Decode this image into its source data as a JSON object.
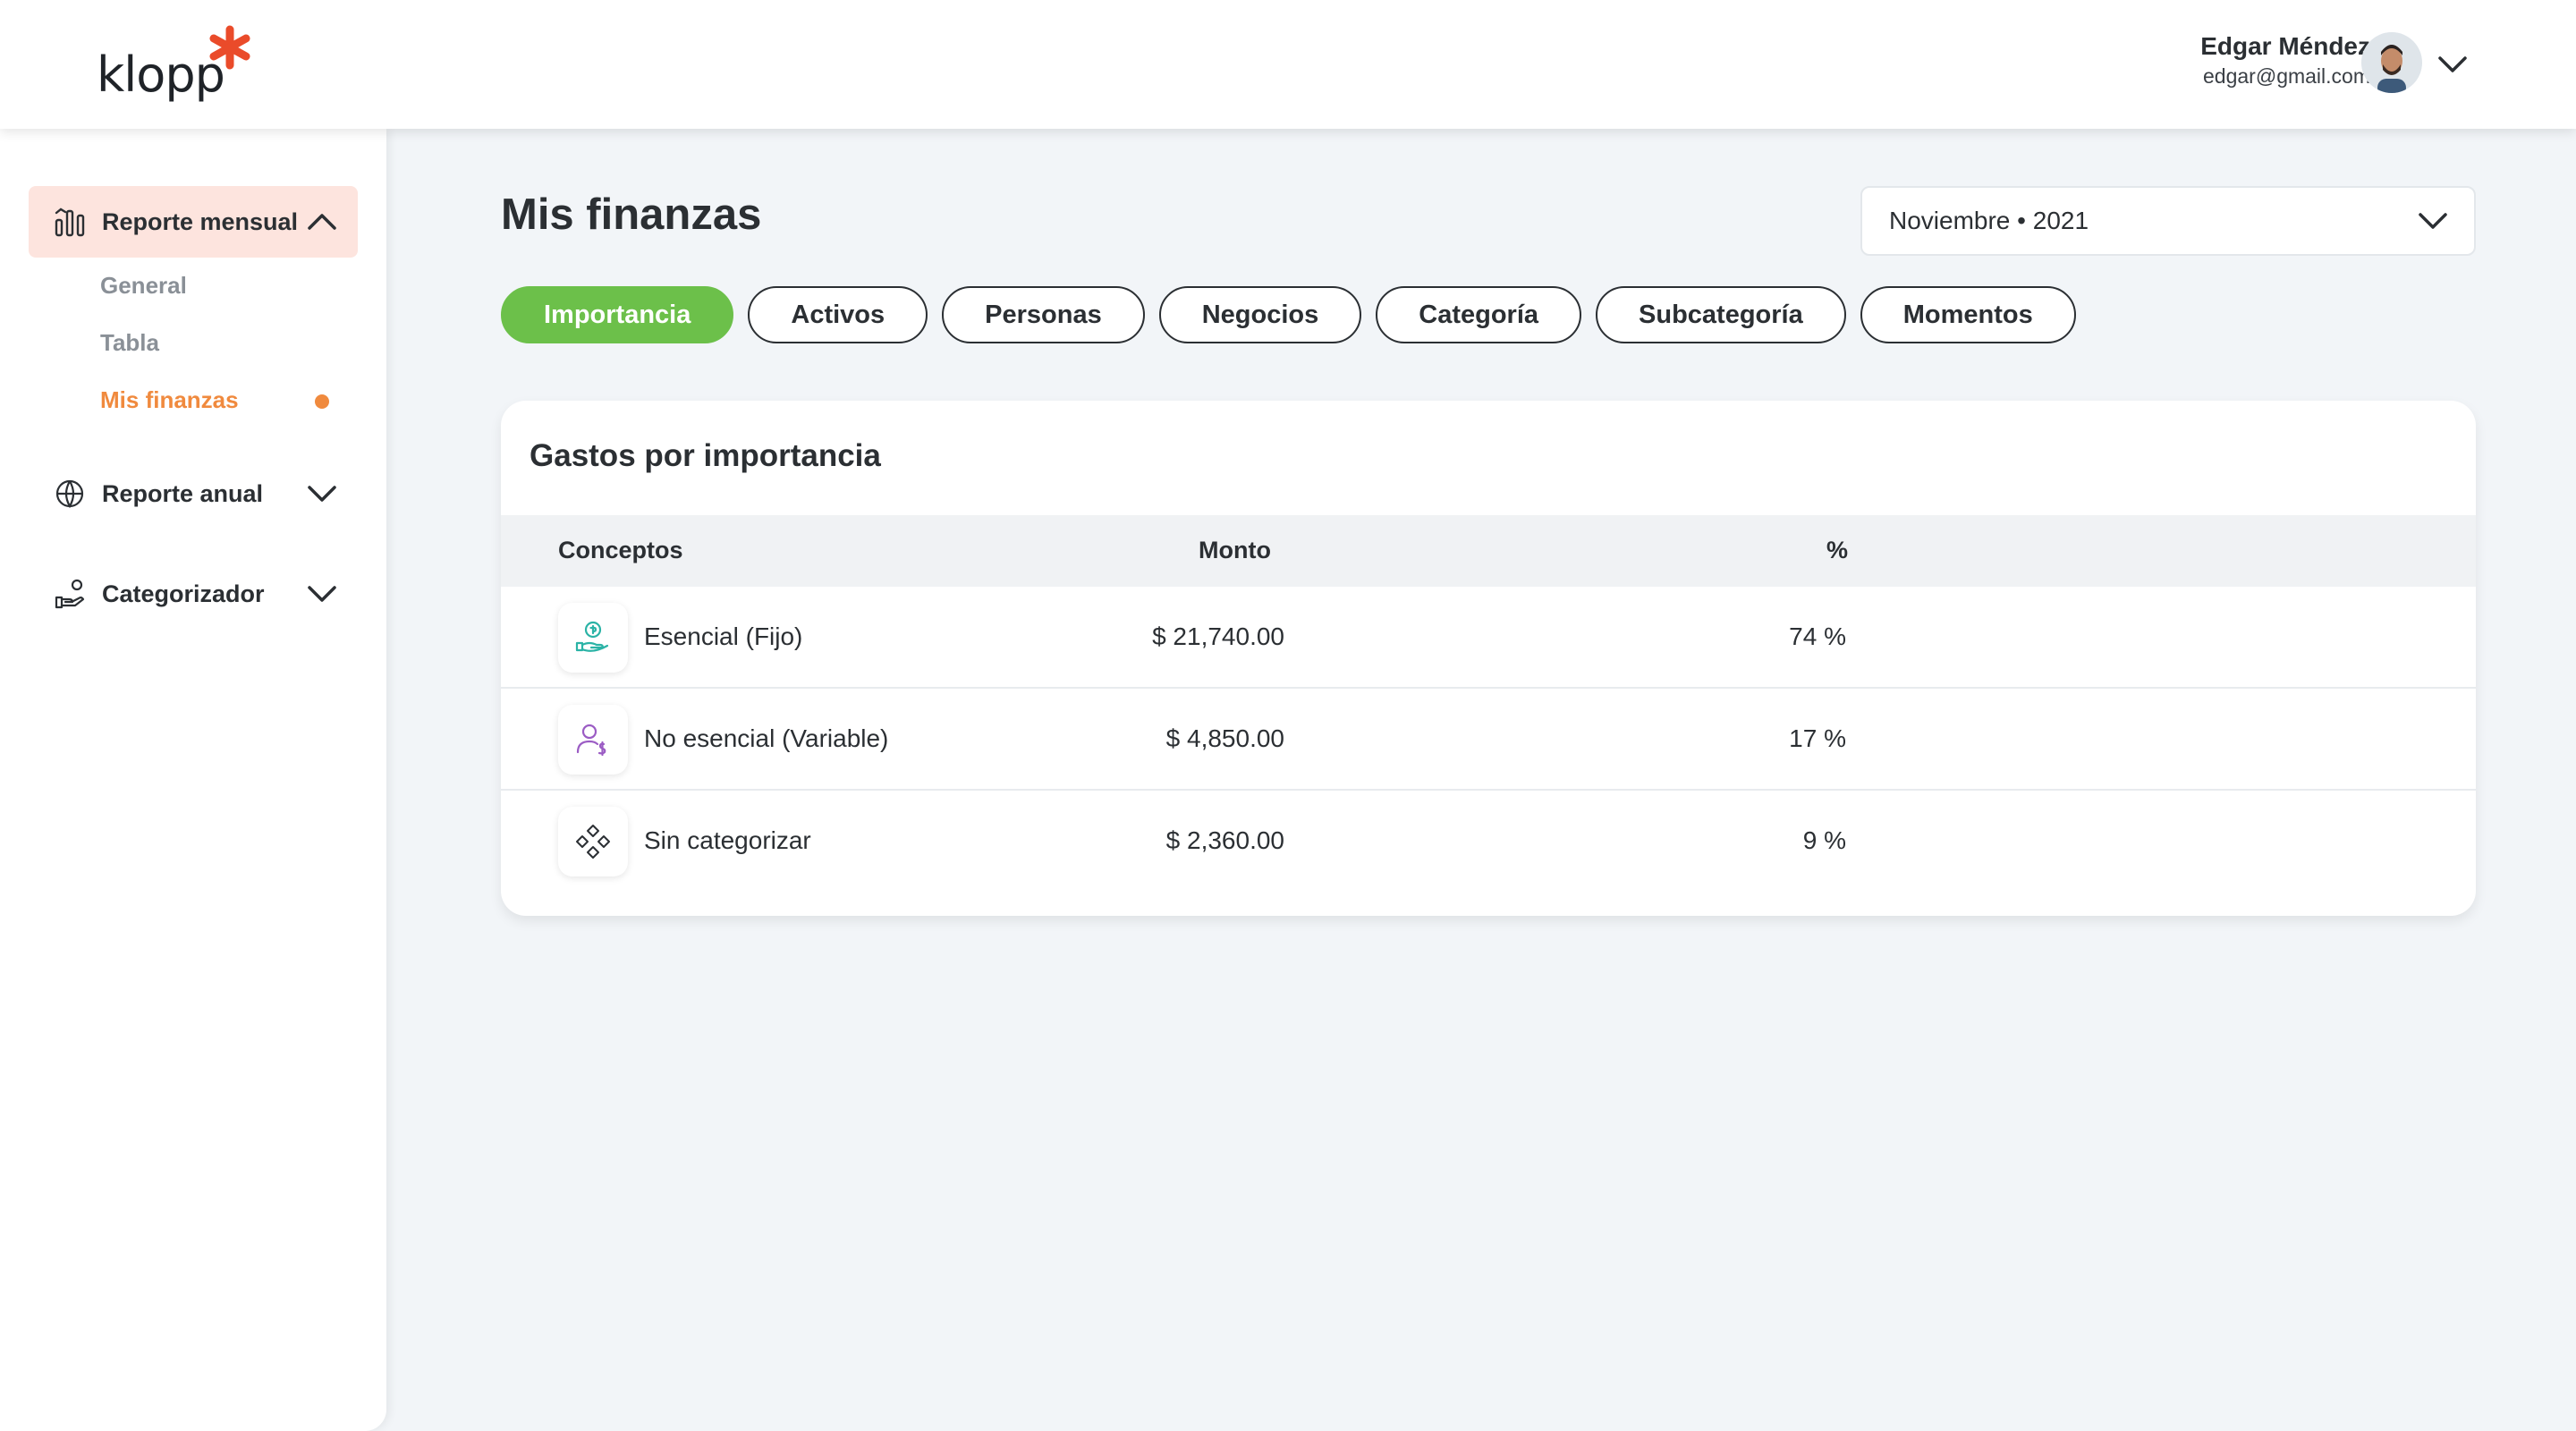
{
  "header": {
    "logo_text": "klopp",
    "user_name": "Edgar Méndez",
    "user_email": "edgar@gmail.com",
    "avatar_icon": "avatar-photo",
    "menu_icon": "chevron-down-icon"
  },
  "sidebar": {
    "sections": [
      {
        "label": "Reporte mensual",
        "icon": "bar-chart-icon",
        "expanded": true
      },
      {
        "label": "Reporte anual",
        "icon": "globe-dollar-icon",
        "expanded": false
      },
      {
        "label": "Categorizador",
        "icon": "hand-coins-icon",
        "expanded": false
      }
    ],
    "sub_items": [
      {
        "label": "General",
        "active": false
      },
      {
        "label": "Tabla",
        "active": false
      },
      {
        "label": "Mis finanzas",
        "active": true
      }
    ]
  },
  "main": {
    "title": "Mis finanzas",
    "period_select": {
      "value": "Noviembre • 2021"
    },
    "tabs": [
      {
        "label": "Importancia",
        "active": true
      },
      {
        "label": "Activos",
        "active": false
      },
      {
        "label": "Personas",
        "active": false
      },
      {
        "label": "Negocios",
        "active": false
      },
      {
        "label": "Categoría",
        "active": false
      },
      {
        "label": "Subcategoría",
        "active": false
      },
      {
        "label": "Momentos",
        "active": false
      }
    ],
    "card": {
      "title": "Gastos por importancia",
      "columns": [
        "Conceptos",
        "Monto",
        "%"
      ],
      "rows": [
        {
          "icon": "hand-coin-icon",
          "concept": "Esencial (Fijo)",
          "amount": "$ 21,740.00",
          "percent": "74 %"
        },
        {
          "icon": "person-dollar-icon",
          "concept": "No esencial (Variable)",
          "amount": "$ 4,850.00",
          "percent": "17 %"
        },
        {
          "icon": "diamonds-icon",
          "concept": "Sin categorizar",
          "amount": "$ 2,360.00",
          "percent": "9 %"
        }
      ]
    }
  },
  "colors": {
    "accent_green": "#6cc04a",
    "accent_orange": "#f08a3e",
    "active_menu_bg": "#fde4de",
    "logo_red": "#ea4b2a"
  }
}
